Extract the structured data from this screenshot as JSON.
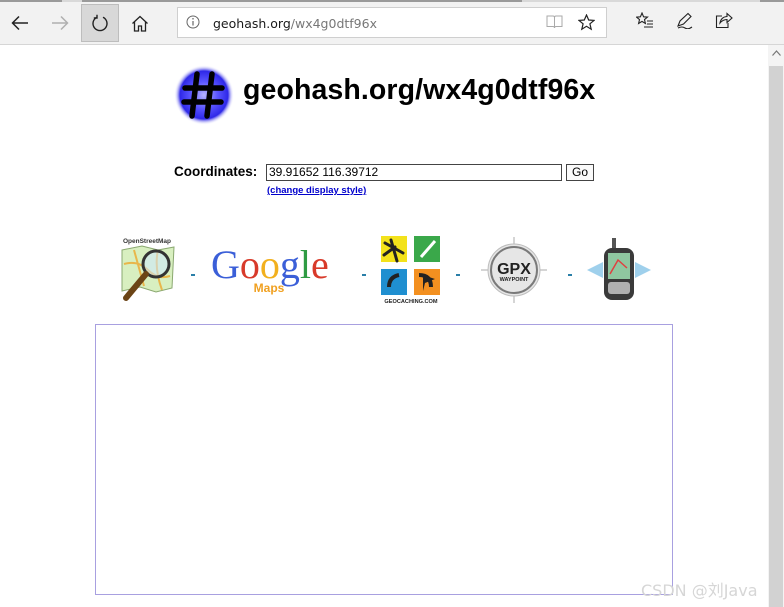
{
  "browser": {
    "address": {
      "host": "geohash.org",
      "path": "/wx4g0dtf96x"
    },
    "icons": {
      "back": "back-arrow-icon",
      "forward": "forward-arrow-icon",
      "refresh": "refresh-icon",
      "home": "home-icon",
      "site_info": "info-icon",
      "reading_view": "reading-view-icon",
      "favorite": "star-icon",
      "favorites_hub": "favorites-list-icon",
      "notes": "pen-icon",
      "share": "share-icon"
    }
  },
  "page": {
    "title": "geohash.org/wx4g0dtf96x",
    "coordinates_label": "Coordinates:",
    "coordinates_value": "39.91652 116.39712",
    "go_label": "Go",
    "change_style_link": "(change display style)",
    "services": {
      "osm_label": "OpenStreetMap",
      "google_word": "Google",
      "google_maps": "Maps",
      "geocaching_label": "GEOCACHING.COM",
      "gpx_main": "GPX",
      "gpx_sub": "WAYPOINT"
    }
  },
  "watermark": "CSDN @刘Java"
}
